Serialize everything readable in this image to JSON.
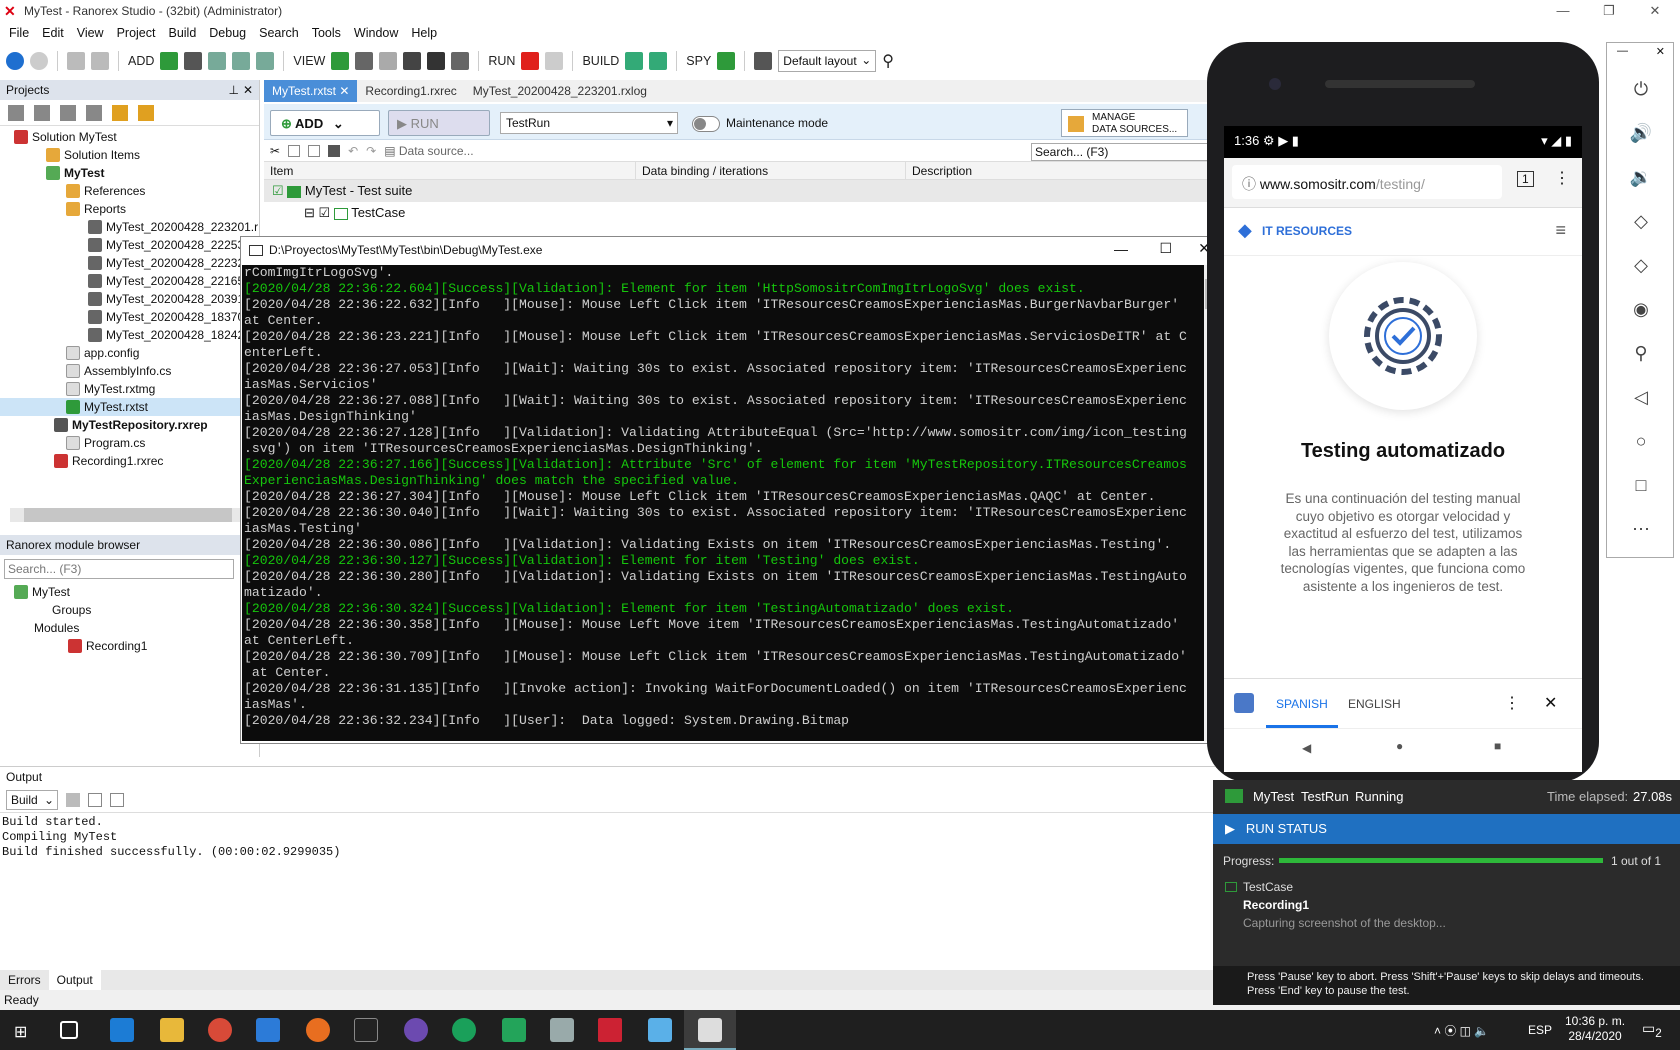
{
  "window": {
    "title": "MyTest - Ranorex Studio - (32bit) (Administrator)"
  },
  "menu": [
    "File",
    "Edit",
    "View",
    "Project",
    "Build",
    "Debug",
    "Search",
    "Tools",
    "Window",
    "Help"
  ],
  "toolbar": {
    "add": "ADD",
    "view": "VIEW",
    "run": "RUN",
    "build": "BUILD",
    "spy": "SPY",
    "layout": "Default layout"
  },
  "projects": {
    "title": "Projects",
    "items": [
      "Solution MyTest",
      "Solution Items",
      "MyTest",
      "References",
      "Reports",
      "MyTest_20200428_223201.r",
      "MyTest_20200428_22253",
      "MyTest_20200428_22232",
      "MyTest_20200428_22165",
      "MyTest_20200428_20391",
      "MyTest_20200428_18370",
      "MyTest_20200428_18242",
      "app.config",
      "AssemblyInfo.cs",
      "MyTest.rxtmg",
      "MyTest.rxtst",
      "MyTestRepository.rxrep",
      "Program.cs",
      "Recording1.rxrec"
    ]
  },
  "module_browser": {
    "title": "Ranorex module browser",
    "search": "Search... (F3)",
    "items": [
      "MyTest",
      "Groups",
      "Modules",
      "Recording1"
    ]
  },
  "tabs": [
    "MyTest.rxtst",
    "Recording1.rxrec",
    "MyTest_20200428_223201.rxlog"
  ],
  "ribbon": {
    "add": "ADD",
    "run": "RUN",
    "testrun": "TestRun",
    "maintenance": "Maintenance mode",
    "manage1": "MANAGE",
    "manage2": "DATA SOURCES...",
    "datasource": "Data source...",
    "search": "Search... (F3)"
  },
  "suite": {
    "cols": [
      "Item",
      "Data binding / iterations",
      "Description"
    ],
    "rows": [
      "MyTest - Test suite",
      "TestCase"
    ]
  },
  "console": {
    "title": "D:\\Proyectos\\MyTest\\MyTest\\bin\\Debug\\MyTest.exe",
    "lines": [
      {
        "t": "rComImgItrLogoSvg'.",
        "ok": false
      },
      {
        "t": "[2020/04/28 22:36:22.604][Success][Validation]: Element for item 'HttpSomositrComImgItrLogoSvg' does exist.",
        "ok": true
      },
      {
        "t": "[2020/04/28 22:36:22.632][Info   ][Mouse]: Mouse Left Click item 'ITResourcesCreamosExperienciasMas.BurgerNavbarBurger'",
        "ok": false
      },
      {
        "t": "at Center.",
        "ok": false
      },
      {
        "t": "[2020/04/28 22:36:23.221][Info   ][Mouse]: Mouse Left Click item 'ITResourcesCreamosExperienciasMas.ServiciosDeITR' at C",
        "ok": false
      },
      {
        "t": "enterLeft.",
        "ok": false
      },
      {
        "t": "[2020/04/28 22:36:27.053][Info   ][Wait]: Waiting 30s to exist. Associated repository item: 'ITResourcesCreamosExperienc",
        "ok": false
      },
      {
        "t": "iasMas.Servicios'",
        "ok": false
      },
      {
        "t": "[2020/04/28 22:36:27.088][Info   ][Wait]: Waiting 30s to exist. Associated repository item: 'ITResourcesCreamosExperienc",
        "ok": false
      },
      {
        "t": "iasMas.DesignThinking'",
        "ok": false
      },
      {
        "t": "[2020/04/28 22:36:27.128][Info   ][Validation]: Validating AttributeEqual (Src='http://www.somositr.com/img/icon_testing",
        "ok": false
      },
      {
        "t": ".svg') on item 'ITResourcesCreamosExperienciasMas.DesignThinking'.",
        "ok": false
      },
      {
        "t": "[2020/04/28 22:36:27.166][Success][Validation]: Attribute 'Src' of element for item 'MyTestRepository.ITResourcesCreamos",
        "ok": true
      },
      {
        "t": "ExperienciasMas.DesignThinking' does match the specified value.",
        "ok": true
      },
      {
        "t": "[2020/04/28 22:36:27.304][Info   ][Mouse]: Mouse Left Click item 'ITResourcesCreamosExperienciasMas.QAQC' at Center.",
        "ok": false
      },
      {
        "t": "[2020/04/28 22:36:30.040][Info   ][Wait]: Waiting 30s to exist. Associated repository item: 'ITResourcesCreamosExperienc",
        "ok": false
      },
      {
        "t": "iasMas.Testing'",
        "ok": false
      },
      {
        "t": "[2020/04/28 22:36:30.086][Info   ][Validation]: Validating Exists on item 'ITResourcesCreamosExperienciasMas.Testing'.",
        "ok": false
      },
      {
        "t": "[2020/04/28 22:36:30.127][Success][Validation]: Element for item 'Testing' does exist.",
        "ok": true
      },
      {
        "t": "[2020/04/28 22:36:30.280][Info   ][Validation]: Validating Exists on item 'ITResourcesCreamosExperienciasMas.TestingAuto",
        "ok": false
      },
      {
        "t": "matizado'.",
        "ok": false
      },
      {
        "t": "[2020/04/28 22:36:30.324][Success][Validation]: Element for item 'TestingAutomatizado' does exist.",
        "ok": true
      },
      {
        "t": "[2020/04/28 22:36:30.358][Info   ][Mouse]: Mouse Left Move item 'ITResourcesCreamosExperienciasMas.TestingAutomatizado'",
        "ok": false
      },
      {
        "t": "at CenterLeft.",
        "ok": false
      },
      {
        "t": "[2020/04/28 22:36:30.709][Info   ][Mouse]: Mouse Left Click item 'ITResourcesCreamosExperienciasMas.TestingAutomatizado'",
        "ok": false
      },
      {
        "t": " at Center.",
        "ok": false
      },
      {
        "t": "[2020/04/28 22:36:31.135][Info   ][Invoke action]: Invoking WaitForDocumentLoaded() on item 'ITResourcesCreamosExperienc",
        "ok": false
      },
      {
        "t": "iasMas'.",
        "ok": false
      },
      {
        "t": "[2020/04/28 22:36:32.234][Info   ][User]:  Data logged: System.Drawing.Bitmap",
        "ok": false
      }
    ]
  },
  "output": {
    "title": "Output",
    "select": "Build",
    "lines": [
      "Build started.",
      "Compiling MyTest",
      "Build finished successfully. (00:00:02.9299035)"
    ]
  },
  "bottom_tabs": [
    "Errors",
    "Output"
  ],
  "status": "Ready",
  "phone": {
    "time": "1:36",
    "url_main": "www.somositr.com",
    "url_path": "/testing/",
    "brand": "IT RESOURCES",
    "heading": "Testing automatizado",
    "body": [
      "Es una continuación del testing manual",
      "cuyo objetivo es otorgar velocidad y",
      "exactitud al esfuerzo del test, utilizamos",
      "las herramientas que se adapten a las",
      "tecnologías vigentes, que funciona como",
      "asistente a los ingenieros de test."
    ],
    "translate": {
      "lang1": "SPANISH",
      "lang2": "ENGLISH"
    }
  },
  "run_status": {
    "project": "MyTest",
    "testrun": "TestRun",
    "state": "Running",
    "elapsed_label": "Time elapsed:",
    "elapsed": "27.08s",
    "header": "RUN STATUS",
    "progress_label": "Progress:",
    "progress_text": "1 out of 1",
    "progress": 1.0,
    "testcase": "TestCase",
    "module": "Recording1",
    "activity": "Capturing screenshot of the desktop...",
    "hint1": "Press 'Pause' key to abort. Press 'Shift'+'Pause' keys to skip delays and timeouts.",
    "hint2": "Press 'End' key to pause the test."
  },
  "taskbar": {
    "lang": "ESP",
    "time": "10:36 p. m.",
    "date": "28/4/2020",
    "notif": "2"
  }
}
